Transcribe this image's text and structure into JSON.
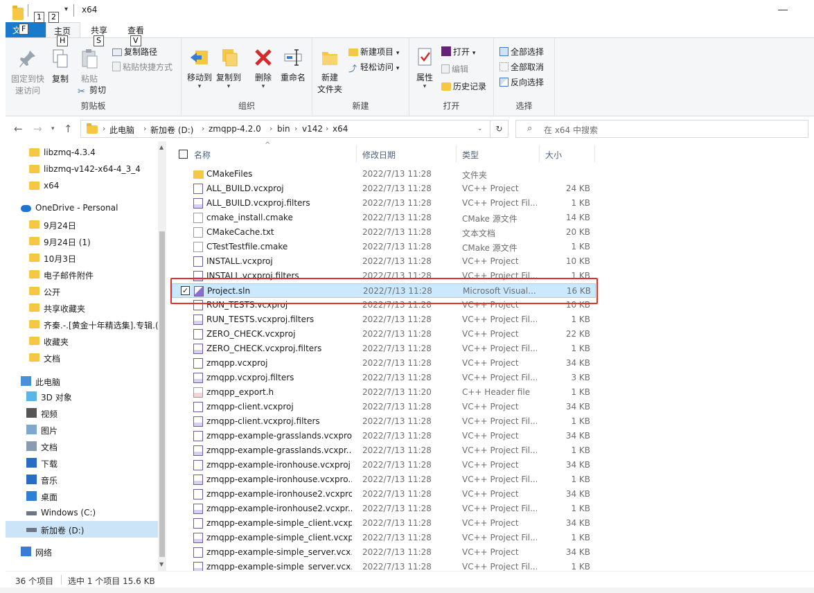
{
  "window": {
    "title": "x64"
  },
  "keytips": {
    "qa1": "1",
    "qa2": "2",
    "file": "F",
    "home": "H",
    "share": "S",
    "view": "V"
  },
  "tabs": {
    "file": "文件",
    "home": "主页",
    "share": "共享",
    "view": "查看"
  },
  "ribbon": {
    "clipboard": {
      "label": "剪贴板",
      "pin": "固定到快\n速访问",
      "pin_l1": "固定到快",
      "pin_l2": "速访问",
      "copy": "复制",
      "paste": "粘贴",
      "copy_path": "复制路径",
      "paste_shortcut": "粘贴快捷方式",
      "cut": "剪切"
    },
    "organize": {
      "label": "组织",
      "move_to": "移动到",
      "copy_to": "复制到",
      "delete": "删除",
      "rename": "重命名"
    },
    "new": {
      "label": "新建",
      "new_folder_l1": "新建",
      "new_folder_l2": "文件夹",
      "new_item": "新建项目",
      "easy_access": "轻松访问"
    },
    "open": {
      "label": "打开",
      "properties": "属性",
      "open": "打开",
      "edit": "编辑",
      "history": "历史记录"
    },
    "select": {
      "label": "选择",
      "select_all": "全部选择",
      "select_none": "全部取消",
      "invert": "反向选择"
    }
  },
  "address": {
    "crumbs": [
      "此电脑",
      "新加卷 (D:)",
      "zmqpp-4.2.0",
      "bin",
      "v142",
      "x64"
    ],
    "search_placeholder": "在 x64 中搜索"
  },
  "nav": [
    {
      "label": "libzmq-4.3.4",
      "icon": "folder"
    },
    {
      "label": "libzmq-v142-x64-4_3_4",
      "icon": "folder"
    },
    {
      "label": "x64",
      "icon": "folder"
    },
    {
      "label": "OneDrive - Personal",
      "icon": "cloud"
    },
    {
      "label": "9月24日",
      "icon": "folder"
    },
    {
      "label": "9月24日 (1)",
      "icon": "folder"
    },
    {
      "label": "10月3日",
      "icon": "folder"
    },
    {
      "label": "电子邮件附件",
      "icon": "folder"
    },
    {
      "label": "公开",
      "icon": "folder"
    },
    {
      "label": "共享收藏夹",
      "icon": "folder"
    },
    {
      "label": "齐秦.-.[黄金十年精选集].专辑.(",
      "icon": "folder"
    },
    {
      "label": "收藏夹",
      "icon": "folder"
    },
    {
      "label": "文档",
      "icon": "folder"
    },
    {
      "label": "此电脑",
      "icon": "pc"
    },
    {
      "label": "3D 对象",
      "icon": "3d"
    },
    {
      "label": "视频",
      "icon": "video"
    },
    {
      "label": "图片",
      "icon": "picture"
    },
    {
      "label": "文档",
      "icon": "document"
    },
    {
      "label": "下载",
      "icon": "download"
    },
    {
      "label": "音乐",
      "icon": "music"
    },
    {
      "label": "桌面",
      "icon": "desktop"
    },
    {
      "label": "Windows (C:)",
      "icon": "drive"
    },
    {
      "label": "新加卷 (D:)",
      "icon": "drive"
    },
    {
      "label": "网络",
      "icon": "network"
    }
  ],
  "columns": {
    "name": "名称",
    "date": "修改日期",
    "type": "类型",
    "size": "大小"
  },
  "files": [
    {
      "name": "CMakeFiles",
      "date": "2022/7/13 11:28",
      "type": "文件夹",
      "size": "",
      "icon": "folder"
    },
    {
      "name": "ALL_BUILD.vcxproj",
      "date": "2022/7/13 11:28",
      "type": "VC++ Project",
      "size": "24 KB",
      "icon": "vcxproj"
    },
    {
      "name": "ALL_BUILD.vcxproj.filters",
      "date": "2022/7/13 11:28",
      "type": "VC++ Project Fil...",
      "size": "1 KB",
      "icon": "filters"
    },
    {
      "name": "cmake_install.cmake",
      "date": "2022/7/13 11:28",
      "type": "CMake 源文件",
      "size": "14 KB",
      "icon": "text"
    },
    {
      "name": "CMakeCache.txt",
      "date": "2022/7/13 11:28",
      "type": "文本文档",
      "size": "20 KB",
      "icon": "text"
    },
    {
      "name": "CTestTestfile.cmake",
      "date": "2022/7/13 11:28",
      "type": "CMake 源文件",
      "size": "1 KB",
      "icon": "text"
    },
    {
      "name": "INSTALL.vcxproj",
      "date": "2022/7/13 11:28",
      "type": "VC++ Project",
      "size": "10 KB",
      "icon": "vcxproj"
    },
    {
      "name": "INSTALL.vcxproj.filters",
      "date": "2022/7/13 11:28",
      "type": "VC++ Project Fil...",
      "size": "1 KB",
      "icon": "filters"
    },
    {
      "name": "Project.sln",
      "date": "2022/7/13 11:28",
      "type": "Microsoft Visual...",
      "size": "16 KB",
      "icon": "sln",
      "selected": true
    },
    {
      "name": "RUN_TESTS.vcxproj",
      "date": "2022/7/13 11:28",
      "type": "VC++ Project",
      "size": "10 KB",
      "icon": "vcxproj"
    },
    {
      "name": "RUN_TESTS.vcxproj.filters",
      "date": "2022/7/13 11:28",
      "type": "VC++ Project Fil...",
      "size": "1 KB",
      "icon": "filters"
    },
    {
      "name": "ZERO_CHECK.vcxproj",
      "date": "2022/7/13 11:28",
      "type": "VC++ Project",
      "size": "22 KB",
      "icon": "vcxproj"
    },
    {
      "name": "ZERO_CHECK.vcxproj.filters",
      "date": "2022/7/13 11:28",
      "type": "VC++ Project Fil...",
      "size": "1 KB",
      "icon": "filters"
    },
    {
      "name": "zmqpp.vcxproj",
      "date": "2022/7/13 11:28",
      "type": "VC++ Project",
      "size": "34 KB",
      "icon": "vcxproj"
    },
    {
      "name": "zmqpp.vcxproj.filters",
      "date": "2022/7/13 11:28",
      "type": "VC++ Project Fil...",
      "size": "3 KB",
      "icon": "filters"
    },
    {
      "name": "zmqpp_export.h",
      "date": "2022/7/13 11:20",
      "type": "C++ Header file",
      "size": "1 KB",
      "icon": "header"
    },
    {
      "name": "zmqpp-client.vcxproj",
      "date": "2022/7/13 11:28",
      "type": "VC++ Project",
      "size": "34 KB",
      "icon": "vcxproj"
    },
    {
      "name": "zmqpp-client.vcxproj.filters",
      "date": "2022/7/13 11:28",
      "type": "VC++ Project Fil...",
      "size": "1 KB",
      "icon": "filters"
    },
    {
      "name": "zmqpp-example-grasslands.vcxproj",
      "date": "2022/7/13 11:28",
      "type": "VC++ Project",
      "size": "34 KB",
      "icon": "vcxproj"
    },
    {
      "name": "zmqpp-example-grasslands.vcxpr...",
      "date": "2022/7/13 11:28",
      "type": "VC++ Project Fil...",
      "size": "1 KB",
      "icon": "filters"
    },
    {
      "name": "zmqpp-example-ironhouse.vcxproj",
      "date": "2022/7/13 11:28",
      "type": "VC++ Project",
      "size": "34 KB",
      "icon": "vcxproj"
    },
    {
      "name": "zmqpp-example-ironhouse.vcxpro...",
      "date": "2022/7/13 11:28",
      "type": "VC++ Project Fil...",
      "size": "1 KB",
      "icon": "filters"
    },
    {
      "name": "zmqpp-example-ironhouse2.vcxproj",
      "date": "2022/7/13 11:28",
      "type": "VC++ Project",
      "size": "34 KB",
      "icon": "vcxproj"
    },
    {
      "name": "zmqpp-example-ironhouse2.vcxpr...",
      "date": "2022/7/13 11:28",
      "type": "VC++ Project Fil...",
      "size": "1 KB",
      "icon": "filters"
    },
    {
      "name": "zmqpp-example-simple_client.vcxp...",
      "date": "2022/7/13 11:28",
      "type": "VC++ Project",
      "size": "34 KB",
      "icon": "vcxproj"
    },
    {
      "name": "zmqpp-example-simple_client.vcxp...",
      "date": "2022/7/13 11:28",
      "type": "VC++ Project Fil...",
      "size": "1 KB",
      "icon": "filters"
    },
    {
      "name": "zmqpp-example-simple_server.vcx...",
      "date": "2022/7/13 11:28",
      "type": "VC++ Project",
      "size": "34 KB",
      "icon": "vcxproj"
    },
    {
      "name": "zmqpp-example-simple_server.vcx...",
      "date": "2022/7/13 11:28",
      "type": "VC++ Project Fil...",
      "size": "1 KB",
      "icon": "filters"
    }
  ],
  "status": {
    "count": "36 个项目",
    "selection": "选中 1 个项目  15.6 KB"
  },
  "colors": {
    "accent": "#1979ca",
    "selection": "#cce8ff",
    "highlight_box": "#e3312a",
    "folder": "#f5c744"
  }
}
